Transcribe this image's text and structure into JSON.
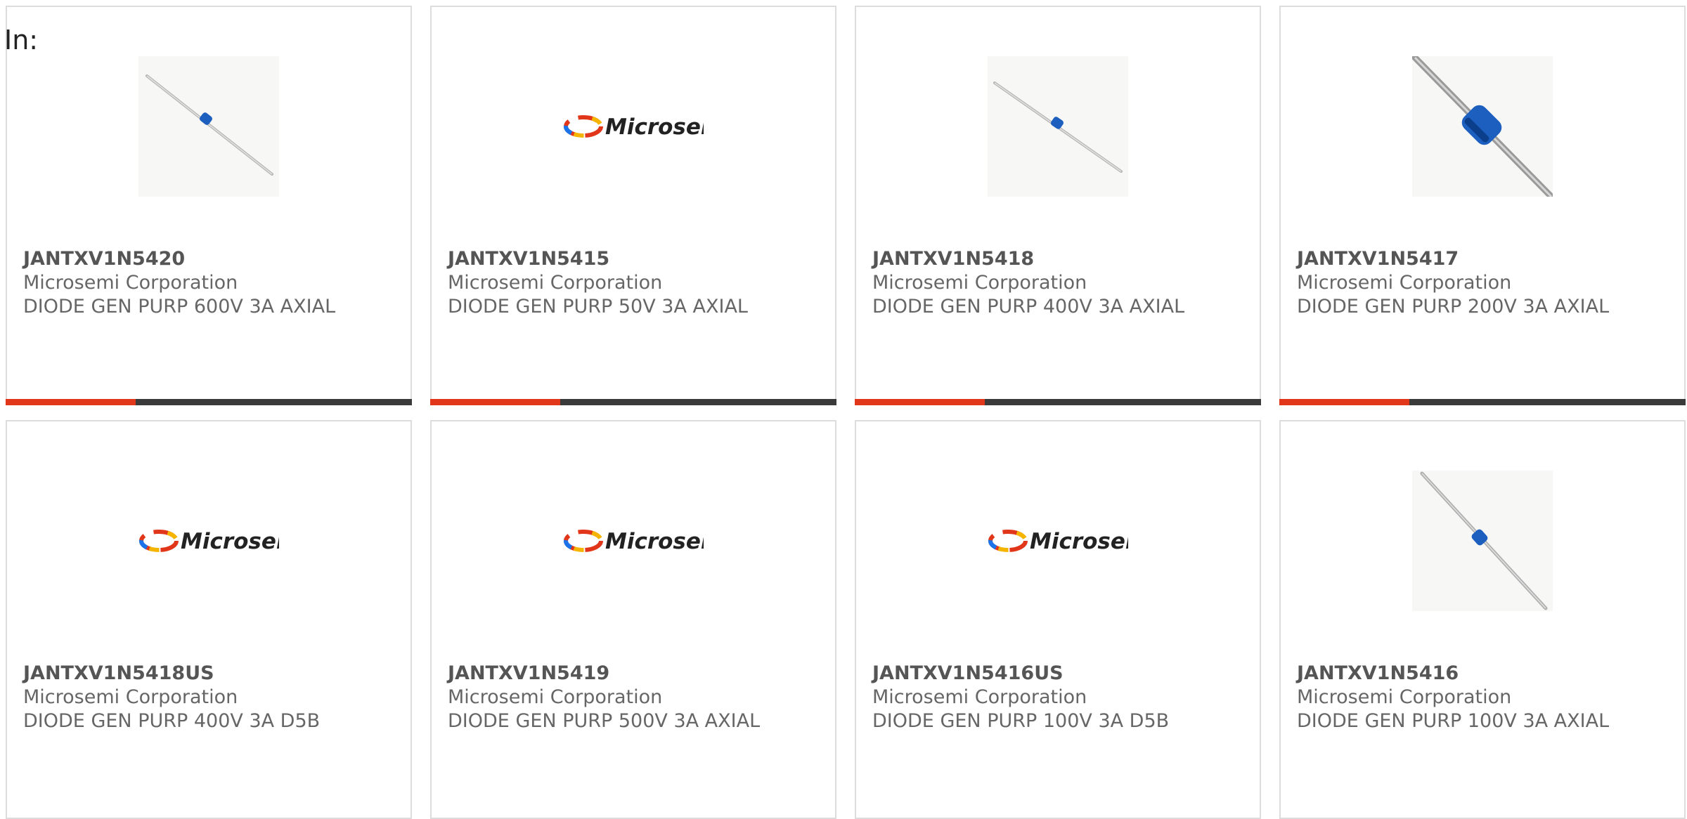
{
  "filter": {
    "label": "In:"
  },
  "colors": {
    "accent": "#e2361b",
    "bar_track": "#3a3a3a",
    "diode_band": "#1d5fbf"
  },
  "products": [
    {
      "part_number": "JANTXV1N5420",
      "manufacturer": "Microsemi Corporation",
      "description": "DIODE GEN PURP 600V 3A AXIAL",
      "image": "diode-axial-image",
      "progress": 0.32
    },
    {
      "part_number": "JANTXV1N5415",
      "manufacturer": "Microsemi Corporation",
      "description": "DIODE GEN PURP 50V 3A AXIAL",
      "image": "microsemi-logo",
      "progress": 0.32
    },
    {
      "part_number": "JANTXV1N5418",
      "manufacturer": "Microsemi Corporation",
      "description": "DIODE GEN PURP 400V 3A AXIAL",
      "image": "diode-axial-image",
      "progress": 0.32
    },
    {
      "part_number": "JANTXV1N5417",
      "manufacturer": "Microsemi Corporation",
      "description": "DIODE GEN PURP 200V 3A AXIAL",
      "image": "diode-axial-large-image",
      "progress": 0.32
    },
    {
      "part_number": "JANTXV1N5418US",
      "manufacturer": "Microsemi Corporation",
      "description": "DIODE GEN PURP 400V 3A D5B",
      "image": "microsemi-logo",
      "progress": 0
    },
    {
      "part_number": "JANTXV1N5419",
      "manufacturer": "Microsemi Corporation",
      "description": "DIODE GEN PURP 500V 3A AXIAL",
      "image": "microsemi-logo",
      "progress": 0
    },
    {
      "part_number": "JANTXV1N5416US",
      "manufacturer": "Microsemi Corporation",
      "description": "DIODE GEN PURP 100V 3A D5B",
      "image": "microsemi-logo",
      "progress": 0
    },
    {
      "part_number": "JANTXV1N5416",
      "manufacturer": "Microsemi Corporation",
      "description": "DIODE GEN PURP 100V 3A AXIAL",
      "image": "diode-axial-image",
      "progress": 0
    }
  ],
  "logo_text": "Microsemi"
}
